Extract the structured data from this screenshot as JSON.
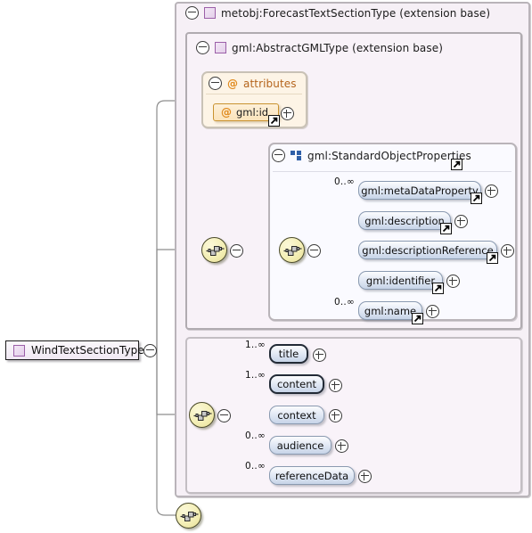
{
  "diagram": {
    "kind": "xsd-schema-tree",
    "root": {
      "label": "WindTextSectionType",
      "icon": "complex-type-icon",
      "collapse": "minus-icon"
    },
    "panels": [
      {
        "id": "forecast-text-section-type",
        "label": "metobj:ForecastTextSectionType (extension base)",
        "icon": "complex-type-icon",
        "collapse": "minus-icon"
      },
      {
        "id": "abstract-gml-type",
        "label": "gml:AbstractGMLType (extension base)",
        "icon": "complex-type-icon",
        "collapse": "minus-icon"
      },
      {
        "id": "attributes",
        "label": "attributes",
        "icon": "attribute-icon",
        "collapse": "minus-icon"
      },
      {
        "id": "standard-object-properties",
        "label": "gml:StandardObjectProperties",
        "icon": "model-group-icon",
        "collapse": "minus-icon",
        "ref": "reference-arrow-icon"
      }
    ],
    "attributes": [
      {
        "name": "gml:id",
        "icon": "attribute-icon",
        "expander": "plus-icon",
        "ref": "reference-arrow-icon"
      }
    ],
    "group_elements": [
      {
        "name": "gml:metaDataProperty",
        "occurs": "0..∞",
        "required": false,
        "expander": "plus-icon",
        "ref": "reference-arrow-icon"
      },
      {
        "name": "gml:description",
        "occurs": "",
        "required": false,
        "expander": "plus-icon",
        "ref": "reference-arrow-icon"
      },
      {
        "name": "gml:descriptionReference",
        "occurs": "",
        "required": false,
        "expander": "plus-icon",
        "ref": "reference-arrow-icon"
      },
      {
        "name": "gml:identifier",
        "occurs": "",
        "required": false,
        "expander": "plus-icon",
        "ref": "reference-arrow-icon"
      },
      {
        "name": "gml:name",
        "occurs": "0..∞",
        "required": false,
        "expander": "plus-icon",
        "ref": "reference-arrow-icon"
      }
    ],
    "section_elements": [
      {
        "name": "title",
        "occurs": "1..∞",
        "required": true,
        "expander": "plus-icon"
      },
      {
        "name": "content",
        "occurs": "1..∞",
        "required": true,
        "expander": "plus-icon"
      },
      {
        "name": "context",
        "occurs": "",
        "required": false,
        "expander": "plus-icon"
      },
      {
        "name": "audience",
        "occurs": "0..∞",
        "required": false,
        "expander": "plus-icon"
      },
      {
        "name": "referenceData",
        "occurs": "0..∞",
        "required": false,
        "expander": "plus-icon"
      }
    ],
    "compositors": [
      {
        "id": "seq-gml-outer",
        "type": "sequence",
        "collapse": "minus-icon"
      },
      {
        "id": "seq-gml-inner",
        "type": "sequence",
        "collapse": "minus-icon"
      },
      {
        "id": "seq-section",
        "type": "sequence",
        "collapse": "minus-icon"
      },
      {
        "id": "seq-bottom",
        "type": "sequence",
        "collapse": ""
      }
    ],
    "colors": {
      "panel_outer_bg": "#f6f0f6",
      "group_panel_bg": "#fafaff",
      "attr_panel_bg": "#fdf4e6",
      "element_fill": "#c7d4e8",
      "sequence_fill": "#f3eeb4",
      "attr_text": "#b5651d",
      "group_icon": "#2f5fa8",
      "type_icon_border": "#9b5fa8"
    }
  }
}
